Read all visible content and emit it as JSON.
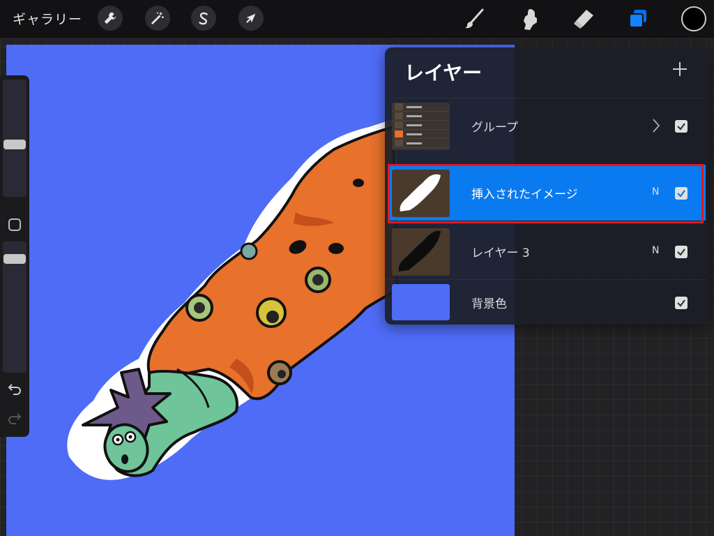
{
  "app": {
    "gallery_label": "ギャラリー"
  },
  "toolbar": {
    "left_tools": [
      "wrench-icon",
      "magic-wand-icon",
      "selection-s-icon",
      "move-arrow-icon"
    ],
    "right_tools": [
      "brush-icon",
      "smudge-icon",
      "eraser-icon",
      "layers-icon"
    ],
    "active_tool": "layers-icon",
    "current_color": "#000000"
  },
  "canvas": {
    "background_color": "#4f6cf7"
  },
  "sidebar": {
    "brush_size_level": 0.45,
    "opacity_level": 0.62
  },
  "layers_panel": {
    "title": "レイヤー",
    "add_icon": "plus-icon",
    "layers": [
      {
        "name": "グループ",
        "blend": "",
        "visible": true,
        "is_group": true,
        "selected": false
      },
      {
        "name": "挿入されたイメージ",
        "blend": "N",
        "visible": true,
        "is_group": false,
        "selected": true
      },
      {
        "name": "レイヤー 3",
        "blend": "N",
        "visible": true,
        "is_group": false,
        "selected": false
      },
      {
        "name": "背景色",
        "blend": "",
        "visible": true,
        "is_group": false,
        "selected": false
      }
    ],
    "selected_color": "#0a7af0",
    "highlight_color": "#e0191f"
  }
}
